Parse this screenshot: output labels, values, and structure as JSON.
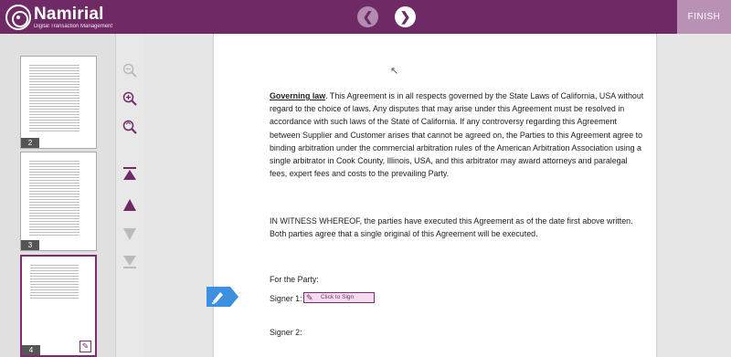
{
  "header": {
    "logo_name": "Namirial",
    "logo_tagline": "Digital Transaction Management",
    "finish_label": "FINISH",
    "prev_icon": "chevron-left-icon",
    "next_icon": "chevron-right-icon"
  },
  "thumbnails": [
    {
      "page": "2",
      "active": false
    },
    {
      "page": "3",
      "active": false
    },
    {
      "page": "4",
      "active": true
    }
  ],
  "document": {
    "governing_heading": "Governing law",
    "governing_text": ". This Agreement is in all respects governed by the State Laws of California, USA without regard to the choice of laws.  Any disputes that may arise under this Agreement must be resolved in accordance with such laws of the State of California.  If any controversy regarding this Agreement between Supplier and Customer arises that cannot be agreed on, the Parties to this Agreement agree to binding arbitration under the commercial arbitration rules of the American Arbitration Association using a single arbitrator in Cook County, Illinois, USA, and this arbitrator may award attorneys and paralegal fees, expert fees and costs to the prevailing Party.",
    "witness_text": "IN WITNESS WHEREOF, the parties have executed this Agreement as of the date first above written. Both parties agree that a single original of this Agreement will be executed.",
    "for_party": "For the Party:",
    "signer1": "Signer 1:",
    "signer2": "Signer 2:",
    "sign_field_label": "Click to Sign"
  },
  "colors": {
    "brand": "#6f2a66",
    "finish_bg": "#b991b4",
    "sign_pin": "#3d8fe0"
  }
}
